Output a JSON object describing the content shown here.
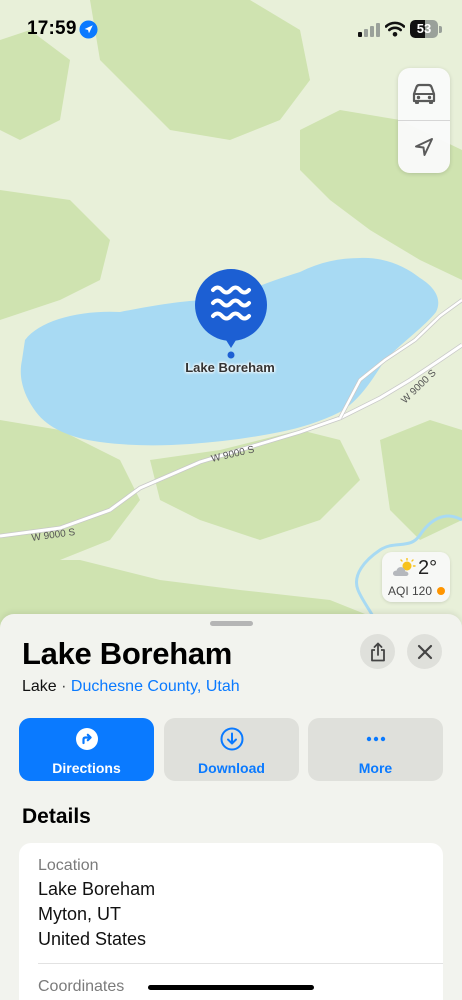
{
  "status_bar": {
    "time": "17:59",
    "battery_level": "53",
    "battery_fraction": 0.53,
    "icons": [
      "location-arrow-icon",
      "cellular-signal-icon",
      "wifi-icon",
      "battery-icon"
    ]
  },
  "map": {
    "colors": {
      "land": "#e8f0d9",
      "forest": "#cfe3b0",
      "water": "#a8daf3",
      "road": "#ffffff",
      "road_edge": "#c8c8c8",
      "pin": "#1c5fd3"
    },
    "controls": [
      {
        "name": "car-icon",
        "label": "Driving"
      },
      {
        "name": "location-arrow-outline-icon",
        "label": "Current location"
      }
    ],
    "pin_label": "Lake Boreham",
    "pin_icon": "water-waves-icon",
    "road_labels": [
      "W 9000 S",
      "W 9000 S",
      "W 9000 S"
    ],
    "weather": {
      "temperature": "2°",
      "aqi": "AQI 120",
      "aqi_color": "#ff9500",
      "icon": "partly-cloudy-icon"
    }
  },
  "sheet": {
    "title": "Lake Boreham",
    "subtitle_type": "Lake",
    "subtitle_separator": " · ",
    "subtitle_location": "Duchesne County, Utah",
    "share_icon": "share-icon",
    "close_icon": "close-icon",
    "actions": [
      {
        "label": "Directions",
        "icon": "directions-icon"
      },
      {
        "label": "Download",
        "icon": "download-icon"
      },
      {
        "label": "More",
        "icon": "more-icon"
      }
    ],
    "details_heading": "Details",
    "details": {
      "location_label": "Location",
      "location_lines": [
        "Lake Boreham",
        "Myton, UT",
        "United States"
      ],
      "coordinates_label": "Coordinates"
    }
  }
}
